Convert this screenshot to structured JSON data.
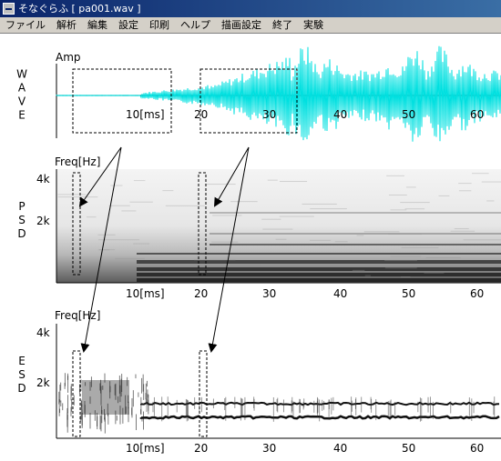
{
  "window": {
    "title": "そなぐらふ  [ pa001.wav ]"
  },
  "menu": [
    "ファイル",
    "解析",
    "編集",
    "設定",
    "印刷",
    "ヘルプ",
    "描画設定",
    "終了",
    "実験"
  ],
  "colors": {
    "wave": "#00e0e0",
    "titlebar": "#0a246a",
    "menubar": "#d4d0c8"
  },
  "panels": {
    "wave": {
      "side_label": "WAVE",
      "axis_label": "Amp",
      "x_ticks": [
        "10[ms]",
        "20",
        "30",
        "40",
        "50",
        "60"
      ]
    },
    "psd": {
      "side_label": "PSD",
      "axis_label": "Freq[Hz]",
      "y_ticks": [
        "4k",
        "2k"
      ],
      "x_ticks": [
        "10[ms]",
        "20",
        "30",
        "40",
        "50",
        "60"
      ]
    },
    "esd": {
      "side_label": "ESD",
      "axis_label": "Freq[Hz]",
      "y_ticks": [
        "4k",
        "2k"
      ],
      "x_ticks": [
        "10[ms]",
        "20",
        "30",
        "40",
        "50",
        "60"
      ]
    }
  }
}
